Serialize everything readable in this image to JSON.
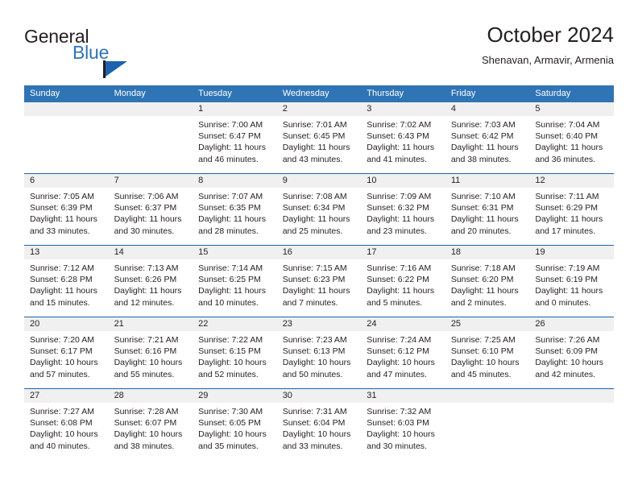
{
  "logo": {
    "word1": "General",
    "word2": "Blue",
    "icon": "flag-triangle-icon",
    "brand_color": "#2f74b5"
  },
  "header": {
    "title": "October 2024",
    "location": "Shenavan, Armavir, Armenia"
  },
  "theme": {
    "header_blue": "#2f74b5",
    "rule_blue": "#1b63ae",
    "daynum_bg": "#f0f0f0",
    "text": "#231f20"
  },
  "calendar": {
    "weekday_headers": [
      "Sunday",
      "Monday",
      "Tuesday",
      "Wednesday",
      "Thursday",
      "Friday",
      "Saturday"
    ],
    "weeks": [
      [
        {
          "day": "",
          "empty": true
        },
        {
          "day": "",
          "empty": true
        },
        {
          "day": "1",
          "sunrise": "Sunrise: 7:00 AM",
          "sunset": "Sunset: 6:47 PM",
          "daylight": "Daylight: 11 hours and 46 minutes."
        },
        {
          "day": "2",
          "sunrise": "Sunrise: 7:01 AM",
          "sunset": "Sunset: 6:45 PM",
          "daylight": "Daylight: 11 hours and 43 minutes."
        },
        {
          "day": "3",
          "sunrise": "Sunrise: 7:02 AM",
          "sunset": "Sunset: 6:43 PM",
          "daylight": "Daylight: 11 hours and 41 minutes."
        },
        {
          "day": "4",
          "sunrise": "Sunrise: 7:03 AM",
          "sunset": "Sunset: 6:42 PM",
          "daylight": "Daylight: 11 hours and 38 minutes."
        },
        {
          "day": "5",
          "sunrise": "Sunrise: 7:04 AM",
          "sunset": "Sunset: 6:40 PM",
          "daylight": "Daylight: 11 hours and 36 minutes."
        }
      ],
      [
        {
          "day": "6",
          "sunrise": "Sunrise: 7:05 AM",
          "sunset": "Sunset: 6:39 PM",
          "daylight": "Daylight: 11 hours and 33 minutes."
        },
        {
          "day": "7",
          "sunrise": "Sunrise: 7:06 AM",
          "sunset": "Sunset: 6:37 PM",
          "daylight": "Daylight: 11 hours and 30 minutes."
        },
        {
          "day": "8",
          "sunrise": "Sunrise: 7:07 AM",
          "sunset": "Sunset: 6:35 PM",
          "daylight": "Daylight: 11 hours and 28 minutes."
        },
        {
          "day": "9",
          "sunrise": "Sunrise: 7:08 AM",
          "sunset": "Sunset: 6:34 PM",
          "daylight": "Daylight: 11 hours and 25 minutes."
        },
        {
          "day": "10",
          "sunrise": "Sunrise: 7:09 AM",
          "sunset": "Sunset: 6:32 PM",
          "daylight": "Daylight: 11 hours and 23 minutes."
        },
        {
          "day": "11",
          "sunrise": "Sunrise: 7:10 AM",
          "sunset": "Sunset: 6:31 PM",
          "daylight": "Daylight: 11 hours and 20 minutes."
        },
        {
          "day": "12",
          "sunrise": "Sunrise: 7:11 AM",
          "sunset": "Sunset: 6:29 PM",
          "daylight": "Daylight: 11 hours and 17 minutes."
        }
      ],
      [
        {
          "day": "13",
          "sunrise": "Sunrise: 7:12 AM",
          "sunset": "Sunset: 6:28 PM",
          "daylight": "Daylight: 11 hours and 15 minutes."
        },
        {
          "day": "14",
          "sunrise": "Sunrise: 7:13 AM",
          "sunset": "Sunset: 6:26 PM",
          "daylight": "Daylight: 11 hours and 12 minutes."
        },
        {
          "day": "15",
          "sunrise": "Sunrise: 7:14 AM",
          "sunset": "Sunset: 6:25 PM",
          "daylight": "Daylight: 11 hours and 10 minutes."
        },
        {
          "day": "16",
          "sunrise": "Sunrise: 7:15 AM",
          "sunset": "Sunset: 6:23 PM",
          "daylight": "Daylight: 11 hours and 7 minutes."
        },
        {
          "day": "17",
          "sunrise": "Sunrise: 7:16 AM",
          "sunset": "Sunset: 6:22 PM",
          "daylight": "Daylight: 11 hours and 5 minutes."
        },
        {
          "day": "18",
          "sunrise": "Sunrise: 7:18 AM",
          "sunset": "Sunset: 6:20 PM",
          "daylight": "Daylight: 11 hours and 2 minutes."
        },
        {
          "day": "19",
          "sunrise": "Sunrise: 7:19 AM",
          "sunset": "Sunset: 6:19 PM",
          "daylight": "Daylight: 11 hours and 0 minutes."
        }
      ],
      [
        {
          "day": "20",
          "sunrise": "Sunrise: 7:20 AM",
          "sunset": "Sunset: 6:17 PM",
          "daylight": "Daylight: 10 hours and 57 minutes."
        },
        {
          "day": "21",
          "sunrise": "Sunrise: 7:21 AM",
          "sunset": "Sunset: 6:16 PM",
          "daylight": "Daylight: 10 hours and 55 minutes."
        },
        {
          "day": "22",
          "sunrise": "Sunrise: 7:22 AM",
          "sunset": "Sunset: 6:15 PM",
          "daylight": "Daylight: 10 hours and 52 minutes."
        },
        {
          "day": "23",
          "sunrise": "Sunrise: 7:23 AM",
          "sunset": "Sunset: 6:13 PM",
          "daylight": "Daylight: 10 hours and 50 minutes."
        },
        {
          "day": "24",
          "sunrise": "Sunrise: 7:24 AM",
          "sunset": "Sunset: 6:12 PM",
          "daylight": "Daylight: 10 hours and 47 minutes."
        },
        {
          "day": "25",
          "sunrise": "Sunrise: 7:25 AM",
          "sunset": "Sunset: 6:10 PM",
          "daylight": "Daylight: 10 hours and 45 minutes."
        },
        {
          "day": "26",
          "sunrise": "Sunrise: 7:26 AM",
          "sunset": "Sunset: 6:09 PM",
          "daylight": "Daylight: 10 hours and 42 minutes."
        }
      ],
      [
        {
          "day": "27",
          "sunrise": "Sunrise: 7:27 AM",
          "sunset": "Sunset: 6:08 PM",
          "daylight": "Daylight: 10 hours and 40 minutes."
        },
        {
          "day": "28",
          "sunrise": "Sunrise: 7:28 AM",
          "sunset": "Sunset: 6:07 PM",
          "daylight": "Daylight: 10 hours and 38 minutes."
        },
        {
          "day": "29",
          "sunrise": "Sunrise: 7:30 AM",
          "sunset": "Sunset: 6:05 PM",
          "daylight": "Daylight: 10 hours and 35 minutes."
        },
        {
          "day": "30",
          "sunrise": "Sunrise: 7:31 AM",
          "sunset": "Sunset: 6:04 PM",
          "daylight": "Daylight: 10 hours and 33 minutes."
        },
        {
          "day": "31",
          "sunrise": "Sunrise: 7:32 AM",
          "sunset": "Sunset: 6:03 PM",
          "daylight": "Daylight: 10 hours and 30 minutes."
        },
        {
          "day": "",
          "empty": true
        },
        {
          "day": "",
          "empty": true
        }
      ]
    ]
  }
}
